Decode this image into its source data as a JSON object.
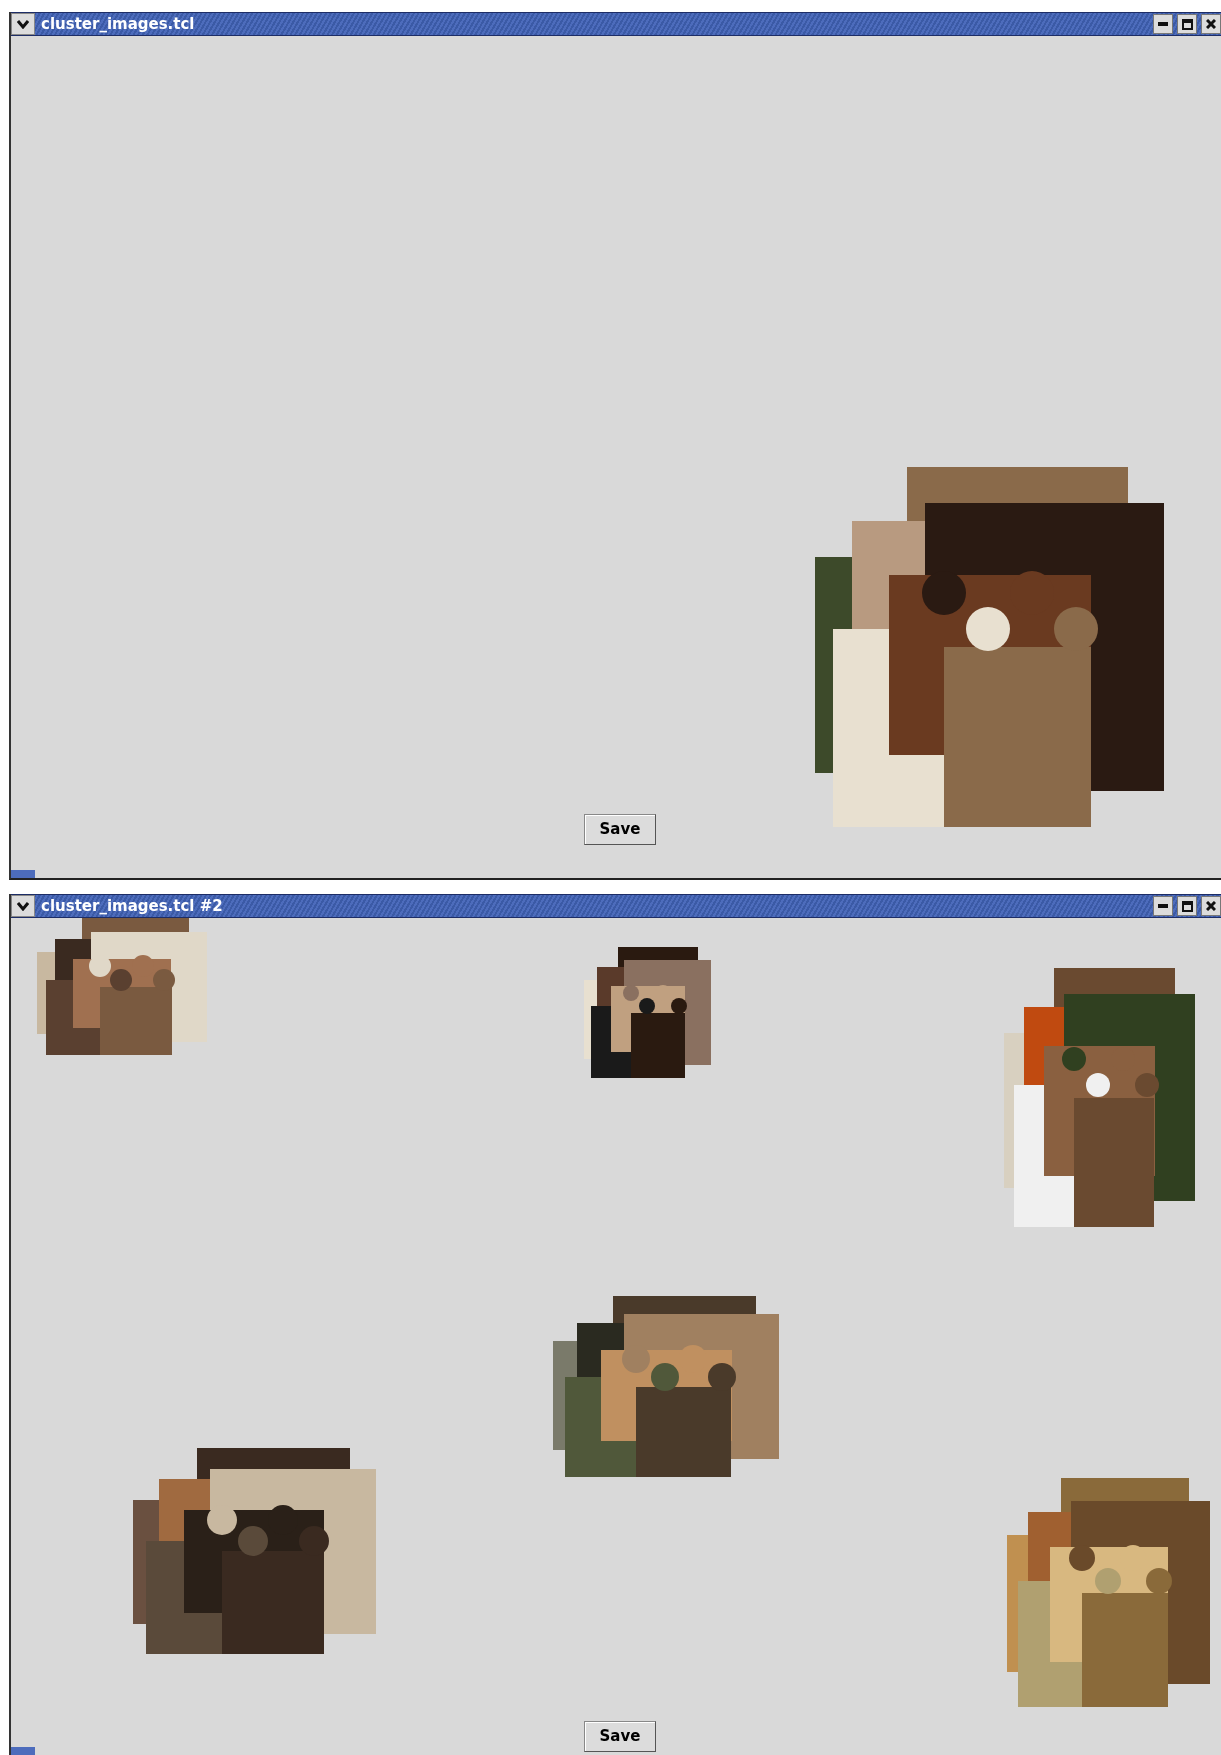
{
  "windows": [
    {
      "title": "cluster_images.tcl",
      "button": "Save"
    },
    {
      "title": "cluster_images.tcl #2",
      "button": "Save"
    }
  ]
}
